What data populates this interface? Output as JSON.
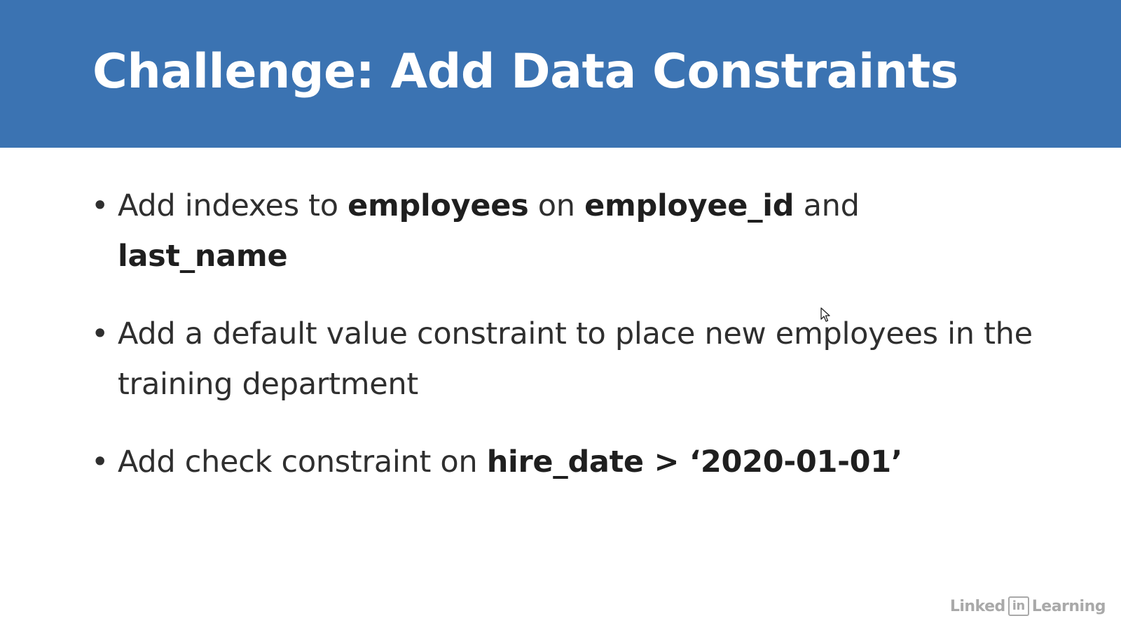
{
  "slide": {
    "title": "Challenge: Add Data Constraints",
    "bullets": [
      {
        "marker": "•",
        "p1": "Add indexes to ",
        "b1": "employees",
        "p2": " on ",
        "b2": "employee_id",
        "p3": " and ",
        "b3": "last_name"
      },
      {
        "marker": "•",
        "text": "Add a default value constraint to place new employees in the training department"
      },
      {
        "marker": "•",
        "p1": "Add check constraint on ",
        "b1": "hire_date > ‘2020-01-01’"
      }
    ]
  },
  "watermark": {
    "left": "Linked",
    "badge": "in",
    "right": "Learning"
  },
  "colors": {
    "title_bar": "#3b73b2",
    "title_text": "#ffffff",
    "body_text": "#2f2f2f"
  },
  "icons": {
    "cursor": "mouse-pointer-icon"
  }
}
